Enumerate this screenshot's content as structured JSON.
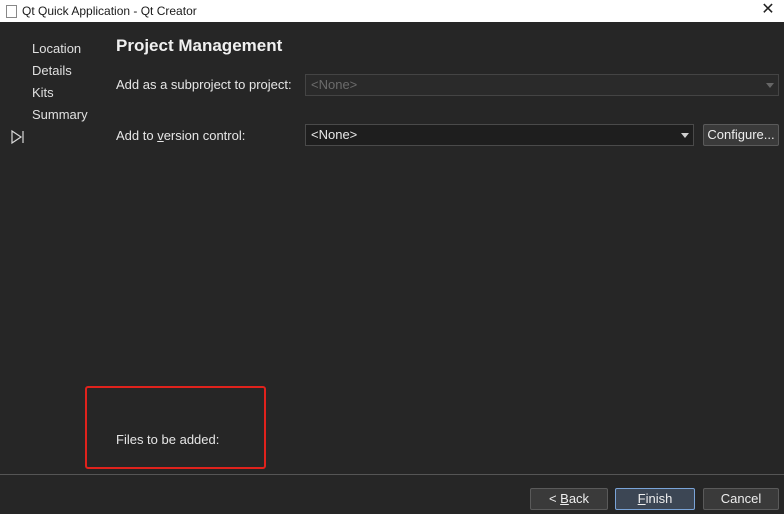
{
  "window": {
    "title": "Qt Quick Application - Qt Creator",
    "close_glyph": "✕"
  },
  "steps": [
    {
      "label": "Location"
    },
    {
      "label": "Details"
    },
    {
      "label": "Kits"
    },
    {
      "label": "Summary",
      "current": true
    }
  ],
  "page": {
    "title": "Project Management",
    "subproject_label_prefix": "Add as a subproject to project:",
    "subproject_value": "<None>",
    "vcs_label_pre": "Add to ",
    "vcs_label_ul": "v",
    "vcs_label_post": "ersion control:",
    "vcs_value": "<None>",
    "configure_label": "Configure...",
    "files_label": "Files to be added:"
  },
  "buttons": {
    "back_prefix": "< ",
    "back_ul": "B",
    "back_rest": "ack",
    "finish_ul": "F",
    "finish_rest": "inish",
    "cancel": "Cancel"
  },
  "colors": {
    "background": "#262626",
    "highlight": "#e0221c",
    "default_button_border": "#7aa4d8"
  }
}
